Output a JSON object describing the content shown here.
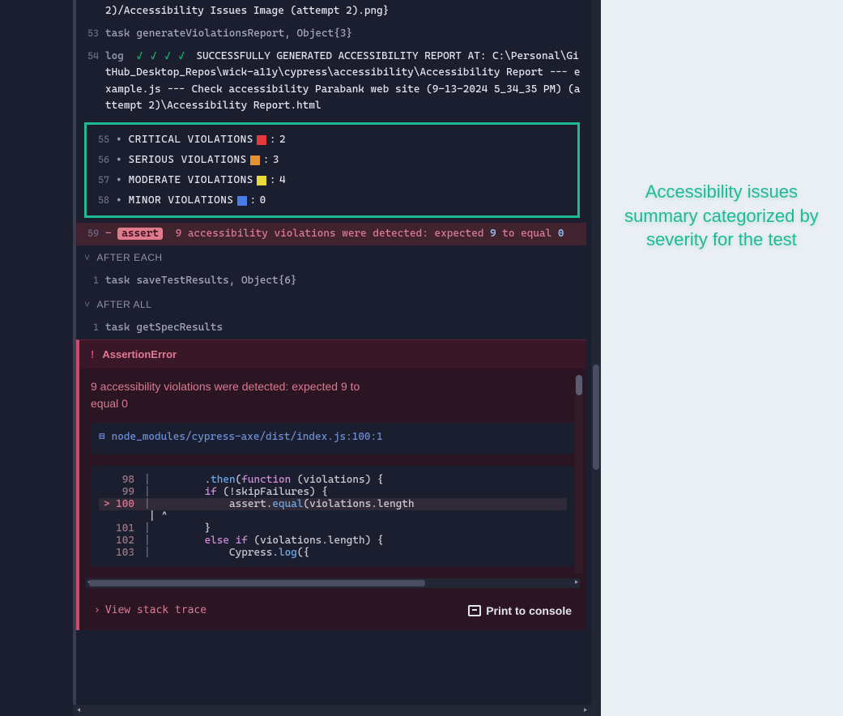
{
  "log_top": {
    "ln": "",
    "text": "2)/Accessibility Issues Image (attempt 2).png}"
  },
  "log_task1": {
    "ln": "53",
    "cmd": "task",
    "args": "generateViolationsReport, Object{3}"
  },
  "log_success": {
    "ln": "54",
    "cmd": "log",
    "checks": "✓ ✓ ✓ ✓",
    "text": "SUCCESSFULLY GENERATED ACCESSIBILITY REPORT AT: C:\\Personal\\GitHub_Desktop_Repos\\wick-a11y\\cypress\\accessibility\\Accessibility Report --- example.js --- Check accessibility Parabank web site (9-13-2024 5_34_35 PM) (attempt 2)\\Accessibility Report.html"
  },
  "violations": [
    {
      "ln": "55",
      "label": "CRITICAL VIOLATIONS",
      "color": "sq-red",
      "count": "2"
    },
    {
      "ln": "56",
      "label": "SERIOUS VIOLATIONS",
      "color": "sq-orange",
      "count": "3"
    },
    {
      "ln": "57",
      "label": "MODERATE VIOLATIONS",
      "color": "sq-yellow",
      "count": "4"
    },
    {
      "ln": "58",
      "label": "MINOR VIOLATIONS",
      "color": "sq-blue",
      "count": "0"
    }
  ],
  "assert_row": {
    "ln": "59",
    "dash": "-",
    "badge": "assert",
    "msg_pre": "9 accessibility violations were detected: expected ",
    "num1": "9",
    "mid": " to equal ",
    "num2": "0"
  },
  "section_after_each": "AFTER EACH",
  "after_each_row": {
    "ln": "1",
    "cmd": "task",
    "args": "saveTestResults, Object{6}"
  },
  "section_after_all": "AFTER ALL",
  "after_all_row": {
    "ln": "1",
    "cmd": "task",
    "args": "getSpecResults"
  },
  "error": {
    "title": "AssertionError",
    "summary": "9 accessibility violations were detected: expected 9 to equal 0",
    "file": "node_modules/cypress-axe/dist/index.js:100:1",
    "code": [
      {
        "ln": "98",
        "src_html": "        .<span class='kw-call'>then</span>(<span class='kw-fn'>function</span> (violations) {"
      },
      {
        "ln": "99",
        "src_html": "        <span class='kw-kw'>if</span> (!skipFailures) {"
      },
      {
        "ln": "100",
        "hl": true,
        "prefix": ">",
        "src_html": "            assert.<span class='kw-call'>equal</span>(violations.length"
      },
      {
        "caret": true,
        "src_html": "| ^"
      },
      {
        "ln": "101",
        "src_html": "        }"
      },
      {
        "ln": "102",
        "src_html": "        <span class='kw-kw'>else if</span> (violations.length) {"
      },
      {
        "ln": "103",
        "src_html": "            Cypress.<span class='kw-call'>log</span>({"
      }
    ],
    "stack_link": "View stack trace",
    "print_btn": "Print to console"
  },
  "annotation": "Accessibility issues summary categorized by severity for the test"
}
